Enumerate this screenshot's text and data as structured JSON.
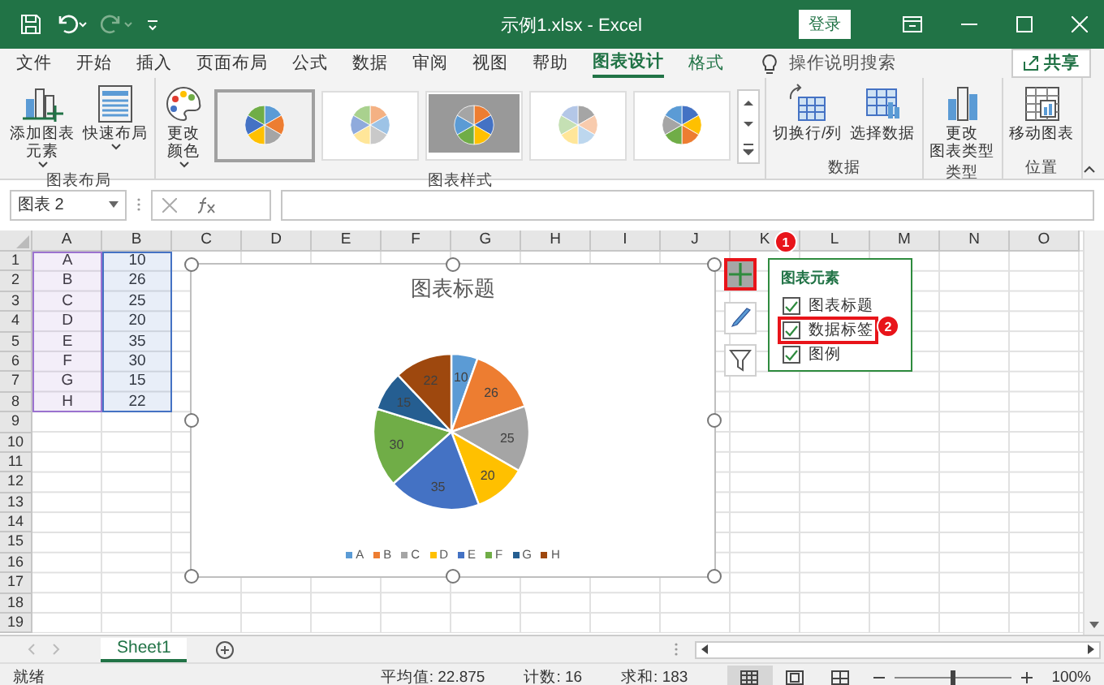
{
  "window": {
    "title": "示例1.xlsx - Excel",
    "sign_in": "登录"
  },
  "tabs": [
    {
      "label": "文件",
      "selected": false,
      "contextual": false
    },
    {
      "label": "开始",
      "selected": false,
      "contextual": false
    },
    {
      "label": "插入",
      "selected": false,
      "contextual": false
    },
    {
      "label": "页面布局",
      "selected": false,
      "contextual": false
    },
    {
      "label": "公式",
      "selected": false,
      "contextual": false
    },
    {
      "label": "数据",
      "selected": false,
      "contextual": false
    },
    {
      "label": "审阅",
      "selected": false,
      "contextual": false
    },
    {
      "label": "视图",
      "selected": false,
      "contextual": false
    },
    {
      "label": "帮助",
      "selected": false,
      "contextual": false
    },
    {
      "label": "图表设计",
      "selected": true,
      "contextual": true
    },
    {
      "label": "格式",
      "selected": false,
      "contextual": true
    }
  ],
  "search": {
    "placeholder": "操作说明搜索"
  },
  "share": "共享",
  "ribbon": {
    "groups": [
      {
        "label": "图表布局",
        "buttons": [
          {
            "kind": "addelement",
            "lines": [
              "添加图表",
              "元素"
            ],
            "dropdown": true
          },
          {
            "kind": "layout",
            "lines": [
              "快速布局"
            ],
            "dropdown": true
          }
        ]
      },
      {
        "label": "图表样式",
        "buttons": [
          {
            "kind": "colors",
            "lines": [
              "更改",
              "颜色"
            ],
            "dropdown": true
          }
        ],
        "gallery": [
          {
            "selected": true
          },
          {
            "selected": false
          },
          {
            "selected": false
          },
          {
            "selected": false
          },
          {
            "selected": false
          }
        ]
      },
      {
        "label": "数据",
        "buttons": [
          {
            "kind": "switch",
            "lines": [
              "切换行/列"
            ],
            "dropdown": false
          },
          {
            "kind": "select",
            "lines": [
              "选择数据"
            ],
            "dropdown": false
          }
        ]
      },
      {
        "label": "类型",
        "buttons": [
          {
            "kind": "changetype",
            "lines": [
              "更改",
              "图表类型"
            ],
            "dropdown": false
          }
        ]
      },
      {
        "label": "位置",
        "buttons": [
          {
            "kind": "move",
            "lines": [
              "移动图表"
            ],
            "dropdown": false
          }
        ]
      }
    ]
  },
  "formula_bar": {
    "name_box": "图表 2"
  },
  "sheet": {
    "columns": [
      "A",
      "B",
      "C",
      "D",
      "E",
      "F",
      "G",
      "H",
      "I",
      "J",
      "K",
      "L",
      "M",
      "N",
      "O"
    ],
    "data_ranges": [
      {
        "color": "#9b72cf"
      },
      {
        "color": "#4472c4"
      }
    ],
    "rows": [
      {
        "header": "1",
        "cells": [
          "A",
          "10"
        ]
      },
      {
        "header": "2",
        "cells": [
          "B",
          "26"
        ]
      },
      {
        "header": "3",
        "cells": [
          "C",
          "25"
        ]
      },
      {
        "header": "4",
        "cells": [
          "D",
          "20"
        ]
      },
      {
        "header": "5",
        "cells": [
          "E",
          "35"
        ]
      },
      {
        "header": "6",
        "cells": [
          "F",
          "30"
        ]
      },
      {
        "header": "7",
        "cells": [
          "G",
          "15"
        ]
      },
      {
        "header": "8",
        "cells": [
          "H",
          "22"
        ]
      },
      {
        "header": "9"
      },
      {
        "header": "10"
      },
      {
        "header": "11"
      },
      {
        "header": "12"
      },
      {
        "header": "13"
      },
      {
        "header": "14"
      },
      {
        "header": "15"
      },
      {
        "header": "16"
      },
      {
        "header": "17"
      },
      {
        "header": "18"
      },
      {
        "header": "19"
      }
    ]
  },
  "chart": {
    "title": "图表标题",
    "chart_data": {
      "type": "pie",
      "categories": [
        "A",
        "B",
        "C",
        "D",
        "E",
        "F",
        "G",
        "H"
      ],
      "values": [
        10,
        26,
        25,
        20,
        35,
        30,
        15,
        22
      ],
      "data_labels": true
    }
  },
  "side_buttons": [
    {
      "kind": "elements",
      "highlighted": true
    },
    {
      "kind": "styles",
      "highlighted": false
    },
    {
      "kind": "filter",
      "highlighted": false
    }
  ],
  "chart_elements": {
    "title": "图表元素",
    "items": [
      {
        "label": "图表标题",
        "checked": true,
        "highlighted": false
      },
      {
        "label": "数据标签",
        "checked": true,
        "highlighted": true
      },
      {
        "label": "图例",
        "checked": true,
        "highlighted": false
      }
    ]
  },
  "callouts": [
    {
      "label": "1"
    },
    {
      "label": "2"
    }
  ],
  "sheet_tabs": [
    {
      "label": "Sheet1",
      "selected": true
    }
  ],
  "status_bar": {
    "ready": "就绪",
    "average": "平均值: 22.875",
    "count": "计数: 16",
    "sum": "求和: 183",
    "views": [
      {
        "selected": true
      },
      {
        "selected": false
      },
      {
        "selected": false
      }
    ],
    "zoom": {
      "level": 0.5,
      "reading": "100%"
    }
  }
}
